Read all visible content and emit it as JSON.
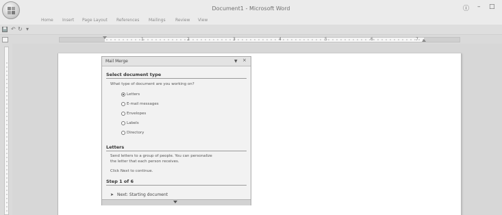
{
  "window": {
    "title": "Document1 - Microsoft Word"
  },
  "ribbon": {
    "tabs": [
      {
        "label": "Home"
      },
      {
        "label": "Insert"
      },
      {
        "label": "Page Layout"
      },
      {
        "label": "References"
      },
      {
        "label": "Mailings"
      },
      {
        "label": "Review"
      },
      {
        "label": "View"
      }
    ]
  },
  "ruler": {
    "numbers": [
      "1",
      "2",
      "3",
      "4",
      "5",
      "6",
      "7"
    ]
  },
  "mail_merge": {
    "title": "Mail Merge",
    "select_type": {
      "heading": "Select document type",
      "question": "What type of document are you working on?",
      "options": [
        {
          "label": "Letters",
          "selected": true
        },
        {
          "label": "E-mail messages",
          "selected": false
        },
        {
          "label": "Envelopes",
          "selected": false
        },
        {
          "label": "Labels",
          "selected": false
        },
        {
          "label": "Directory",
          "selected": false
        }
      ]
    },
    "letters": {
      "heading": "Letters",
      "description_line1": "Send letters to a group of people. You can personalize",
      "description_line2": "the letter that each person receives.",
      "continue_hint": "Click Next to continue."
    },
    "step": {
      "heading": "Step 1 of 6",
      "next_label": "Next: Starting document"
    }
  },
  "icons": {
    "office_button": "office-logo-icon",
    "help": "help-icon",
    "minimize": "minimize-icon",
    "maximize": "maximize-icon",
    "save": "save-icon",
    "undo": "undo-icon",
    "redo": "redo-icon",
    "customize": "dropdown-icon"
  },
  "colors": {
    "chrome": "#ebebeb",
    "workspace": "#d7d7d7",
    "pane": "#f2f2f2"
  }
}
